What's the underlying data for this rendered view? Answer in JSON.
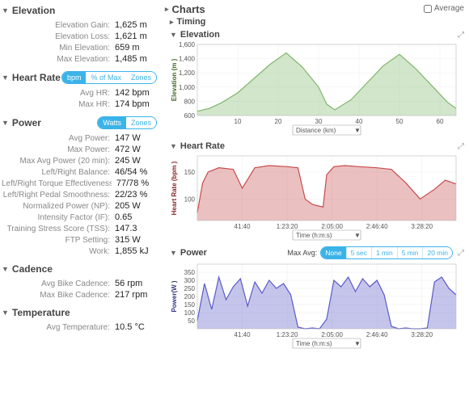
{
  "left": {
    "elevation": {
      "title": "Elevation",
      "rows": [
        {
          "label": "Elevation Gain:",
          "value": "1,625 m"
        },
        {
          "label": "Elevation Loss:",
          "value": "1,621 m"
        },
        {
          "label": "Min Elevation:",
          "value": "659 m"
        },
        {
          "label": "Max Elevation:",
          "value": "1,485 m"
        }
      ]
    },
    "heartRate": {
      "title": "Heart Rate",
      "pills": [
        "bpm",
        "% of Max",
        "Zones"
      ],
      "activePill": 0,
      "rows": [
        {
          "label": "Avg HR:",
          "value": "142 bpm"
        },
        {
          "label": "Max HR:",
          "value": "174 bpm"
        }
      ]
    },
    "power": {
      "title": "Power",
      "pills": [
        "Watts",
        "Zones"
      ],
      "activePill": 0,
      "rows": [
        {
          "label": "Avg Power:",
          "value": "147 W"
        },
        {
          "label": "Max Power:",
          "value": "472 W"
        },
        {
          "label": "Max Avg Power (20 min):",
          "value": "245 W"
        },
        {
          "label": "Left/Right Balance:",
          "value": "46/54 %"
        },
        {
          "label": "Left/Right Torque Effectiveness:",
          "value": "77/78 %"
        },
        {
          "label": "Left/Right Pedal Smoothness:",
          "value": "22/23 %"
        },
        {
          "label": "Normalized Power (NP):",
          "value": "205 W"
        },
        {
          "label": "Intensity Factor (IF):",
          "value": "0.65"
        },
        {
          "label": "Training Stress Score (TSS):",
          "value": "147.3"
        },
        {
          "label": "FTP Setting:",
          "value": "315 W"
        },
        {
          "label": "Work:",
          "value": "1,855 kJ"
        }
      ]
    },
    "cadence": {
      "title": "Cadence",
      "rows": [
        {
          "label": "Avg Bike Cadence:",
          "value": "56 rpm"
        },
        {
          "label": "Max Bike Cadence:",
          "value": "217 rpm"
        }
      ]
    },
    "temperature": {
      "title": "Temperature",
      "rows": [
        {
          "label": "Avg Temperature:",
          "value": "10.5 °C"
        }
      ]
    }
  },
  "right": {
    "title": "Charts",
    "averageLabel": "Average",
    "timing": "Timing",
    "elevationTitle": "Elevation",
    "hrTitle": "Heart Rate",
    "powerTitle": "Power",
    "maxAvgLabel": "Max Avg:",
    "maxAvgOptions": [
      "None",
      "5 sec",
      "1 min",
      "5 min",
      "20 min"
    ],
    "maxAvgActive": 0,
    "xSelDistance": "Distance (km)",
    "xSelTime": "Time (h:m:s)",
    "yElev": "Elevation (m )",
    "yHR": "Heart Rate (bpm )",
    "yPow": "Power(W )"
  },
  "chart_data": [
    {
      "type": "area",
      "title": "Elevation",
      "xlabel": "Distance (km)",
      "ylabel": "Elevation (m)",
      "xlim": [
        0,
        64
      ],
      "ylim": [
        600,
        1600
      ],
      "xticks": [
        10,
        20,
        30,
        40,
        50,
        60
      ],
      "yticks": [
        600,
        800,
        1000,
        1200,
        1400,
        1600
      ],
      "series": [
        {
          "name": "Elevation",
          "color": "#7fb76b",
          "x": [
            0,
            3,
            6,
            10,
            14,
            18,
            22,
            26,
            30,
            32,
            34,
            38,
            42,
            46,
            50,
            54,
            58,
            62,
            64
          ],
          "values": [
            660,
            700,
            780,
            920,
            1120,
            1320,
            1480,
            1280,
            1000,
            760,
            680,
            820,
            1060,
            1300,
            1460,
            1260,
            1020,
            780,
            700
          ]
        }
      ]
    },
    {
      "type": "area",
      "title": "Heart Rate",
      "xlabel": "Time (h:m:s)",
      "ylabel": "Heart Rate (bpm)",
      "xlim": [
        0,
        14400
      ],
      "ylim": [
        60,
        180
      ],
      "xticks_labels": [
        "41:40",
        "1:23:20",
        "2:05:00",
        "2:46:40",
        "3:28:20"
      ],
      "xticks": [
        2500,
        5000,
        7500,
        10000,
        12500
      ],
      "yticks": [
        100,
        150
      ],
      "series": [
        {
          "name": "HR",
          "color": "#c74b4b",
          "x": [
            0,
            300,
            600,
            1200,
            2000,
            2500,
            3200,
            4000,
            5000,
            5600,
            6000,
            6400,
            7000,
            7200,
            7600,
            8200,
            9000,
            10000,
            10800,
            11600,
            12400,
            13200,
            13800,
            14400
          ],
          "values": [
            75,
            130,
            150,
            158,
            155,
            120,
            158,
            162,
            160,
            158,
            100,
            90,
            85,
            145,
            160,
            162,
            160,
            158,
            155,
            130,
            100,
            118,
            135,
            128
          ]
        }
      ]
    },
    {
      "type": "area",
      "title": "Power",
      "xlabel": "Time (h:m:s)",
      "ylabel": "Power (W)",
      "xlim": [
        0,
        14400
      ],
      "ylim": [
        0,
        400
      ],
      "xticks_labels": [
        "41:40",
        "1:23:20",
        "2:05:00",
        "2:46:40",
        "3:28:20"
      ],
      "xticks": [
        2500,
        5000,
        7500,
        10000,
        12500
      ],
      "yticks": [
        50,
        100,
        150,
        200,
        250,
        300,
        350
      ],
      "series": [
        {
          "name": "Power",
          "color": "#5a5ac8",
          "x": [
            0,
            400,
            800,
            1200,
            1600,
            2000,
            2400,
            2800,
            3200,
            3600,
            4000,
            4400,
            4800,
            5200,
            5600,
            6000,
            6400,
            6800,
            7200,
            7600,
            8000,
            8400,
            8800,
            9200,
            9600,
            10000,
            10400,
            10800,
            11200,
            11600,
            12000,
            12400,
            12800,
            13200,
            13600,
            14000,
            14400
          ],
          "values": [
            50,
            280,
            120,
            320,
            180,
            260,
            310,
            140,
            290,
            220,
            300,
            250,
            280,
            210,
            10,
            0,
            5,
            0,
            60,
            300,
            260,
            320,
            230,
            310,
            260,
            300,
            210,
            15,
            0,
            5,
            0,
            0,
            5,
            290,
            320,
            250,
            210
          ]
        }
      ]
    }
  ]
}
